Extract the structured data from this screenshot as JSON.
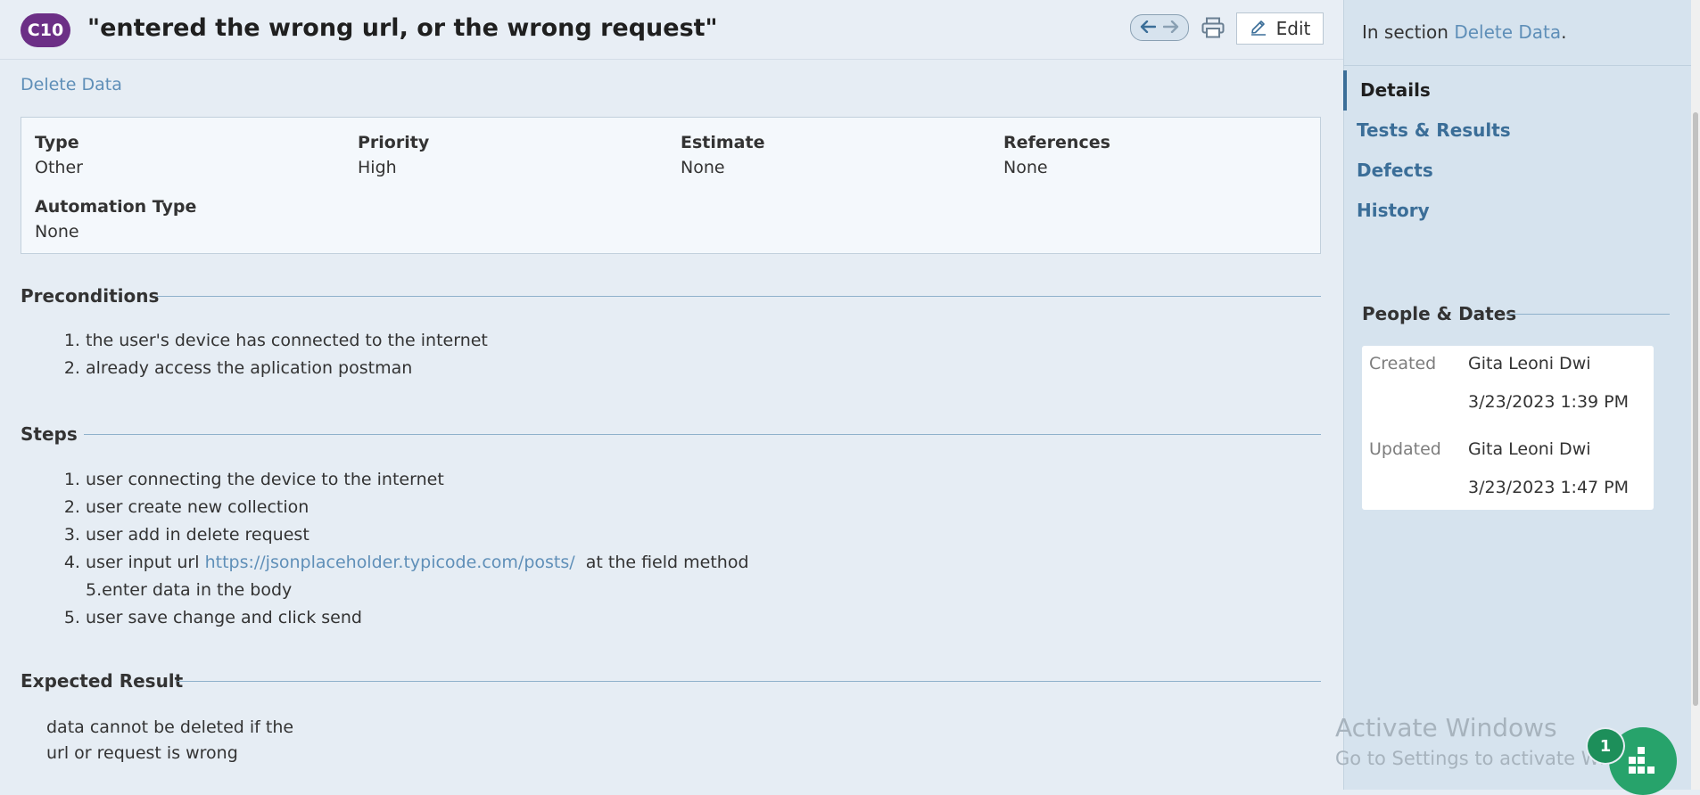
{
  "header": {
    "case_id": "C10",
    "title": "\"entered the wrong url, or the wrong request\"",
    "edit_label": "Edit"
  },
  "section_link": "Delete Data",
  "fields": [
    {
      "label": "Type",
      "value": "Other"
    },
    {
      "label": "Priority",
      "value": "High"
    },
    {
      "label": "Estimate",
      "value": "None"
    },
    {
      "label": "References",
      "value": "None"
    },
    {
      "label": "Automation Type",
      "value": "None"
    }
  ],
  "preconditions": {
    "heading": "Preconditions",
    "items": [
      "the user's device has connected to the internet",
      "already access the aplication postman"
    ]
  },
  "steps": {
    "heading": "Steps",
    "item1": "user connecting the device to the internet",
    "item2": "user create new collection",
    "item3": "user add in delete request",
    "item4_prefix": "user input url ",
    "item4_url": "https://jsonplaceholder.typicode.com/posts/",
    "item4_suffix": "  at the field method",
    "item4_sub": "5.enter data in the body",
    "item5": "user save change and click send"
  },
  "expected": {
    "heading": "Expected Result",
    "line1": "data cannot be deleted if the",
    "line2": "url or request is wrong"
  },
  "sidebar": {
    "in_section_prefix": "In section ",
    "in_section_link": "Delete Data",
    "in_section_suffix": ".",
    "tabs": [
      "Details",
      "Tests & Results",
      "Defects",
      "History"
    ],
    "people_heading": "People & Dates",
    "created_label": "Created",
    "created_by": "Gita Leoni Dwi",
    "created_at": "3/23/2023 1:39 PM",
    "updated_label": "Updated",
    "updated_by": "Gita Leoni Dwi",
    "updated_at": "3/23/2023 1:47 PM"
  },
  "watermark": {
    "line1": "Activate Windows",
    "line2": "Go to Settings to activate Windows."
  },
  "fab": {
    "badge": "1"
  },
  "colors": {
    "accent": "#6c2f86",
    "link": "#5f8fb8",
    "fab": "#27a36b"
  }
}
